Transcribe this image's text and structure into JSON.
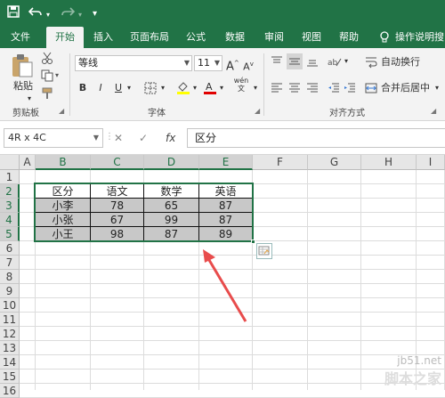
{
  "quick_access": {
    "save": "save-icon",
    "undo": "undo-icon",
    "redo": "redo-icon",
    "customize": "customize-icon"
  },
  "tabs": [
    "文件",
    "开始",
    "插入",
    "页面布局",
    "公式",
    "数据",
    "审阅",
    "视图",
    "帮助",
    "操作说明搜"
  ],
  "active_tab": "开始",
  "ribbon": {
    "clipboard": {
      "paste_label": "粘贴",
      "group_label": "剪贴板"
    },
    "font": {
      "font_name": "等线",
      "font_size": "11",
      "group_label": "字体",
      "bold": "B",
      "italic": "I",
      "underline": "U",
      "grow": "A",
      "shrink": "A",
      "phonetic": "wén 文"
    },
    "alignment": {
      "wrap_text": "自动换行",
      "merge_center": "合并后居中",
      "group_label": "对齐方式"
    }
  },
  "formula_bar": {
    "name_box": "4R x 4C",
    "cancel": "✕",
    "enter": "✓",
    "fx": "fx",
    "value": "区分"
  },
  "columns": [
    "A",
    "B",
    "C",
    "D",
    "E",
    "F",
    "G",
    "H",
    "I"
  ],
  "rows": [
    "1",
    "2",
    "3",
    "4",
    "5",
    "6",
    "7",
    "8",
    "9",
    "10",
    "11",
    "12",
    "13",
    "14",
    "15",
    "16"
  ],
  "table": {
    "headers": [
      "区分",
      "语文",
      "数学",
      "英语"
    ],
    "rows": [
      [
        "小李",
        "78",
        "65",
        "87"
      ],
      [
        "小张",
        "67",
        "99",
        "87"
      ],
      [
        "小王",
        "98",
        "87",
        "89"
      ]
    ]
  },
  "watermark": {
    "line1": "jb51.net",
    "line2": "脚本之家"
  },
  "colors": {
    "accent": "#217346",
    "arrow": "#e84c4c",
    "selection_fill": "#c8c8c8"
  }
}
